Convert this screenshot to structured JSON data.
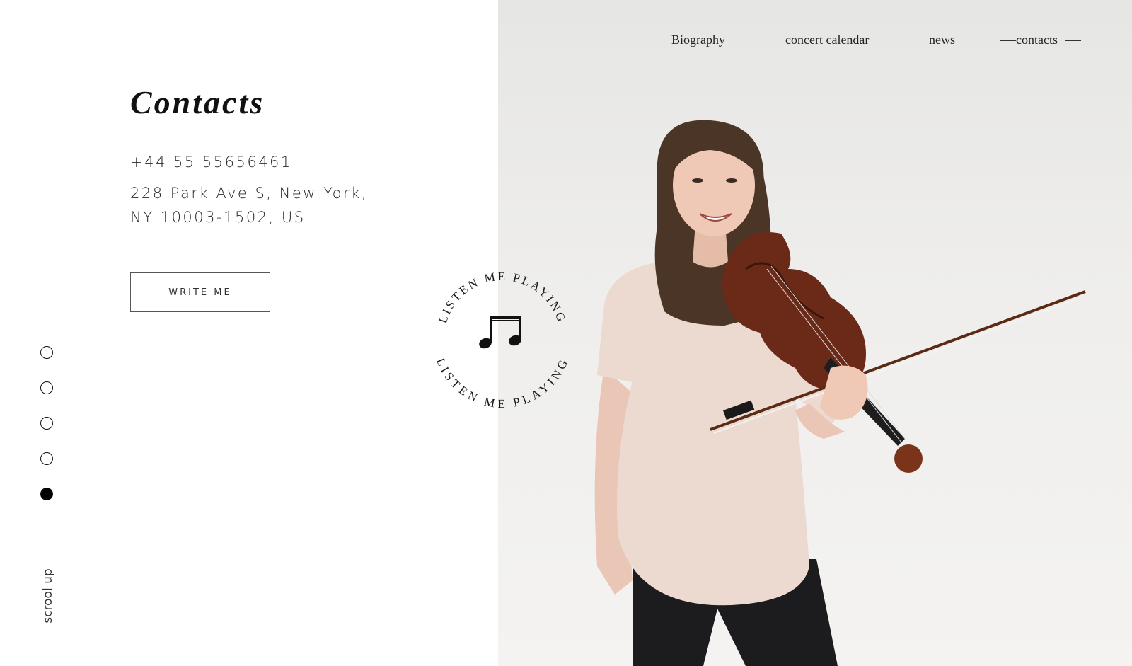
{
  "nav": {
    "items": [
      {
        "label": "Biography"
      },
      {
        "label": "concert calendar"
      },
      {
        "label": "news"
      },
      {
        "label": "contacts",
        "active": true
      }
    ]
  },
  "contacts": {
    "title": "Contacts",
    "phone": "+44 55 55656461",
    "address_line1": "228 Park Ave S, New York,",
    "address_line2": "NY 10003-1502, US",
    "button_label": "WRITE ME"
  },
  "pagination": {
    "total": 5,
    "active_index": 4
  },
  "scroll_label": "scrool up",
  "badge": {
    "text": "LISTEN ME PLAYING",
    "icon": "music-notes-icon"
  },
  "colors": {
    "accent": "#111111",
    "photo_bg": "#eeedeb",
    "shirt": "#ecd9d0",
    "violin": "#6b2a18"
  }
}
